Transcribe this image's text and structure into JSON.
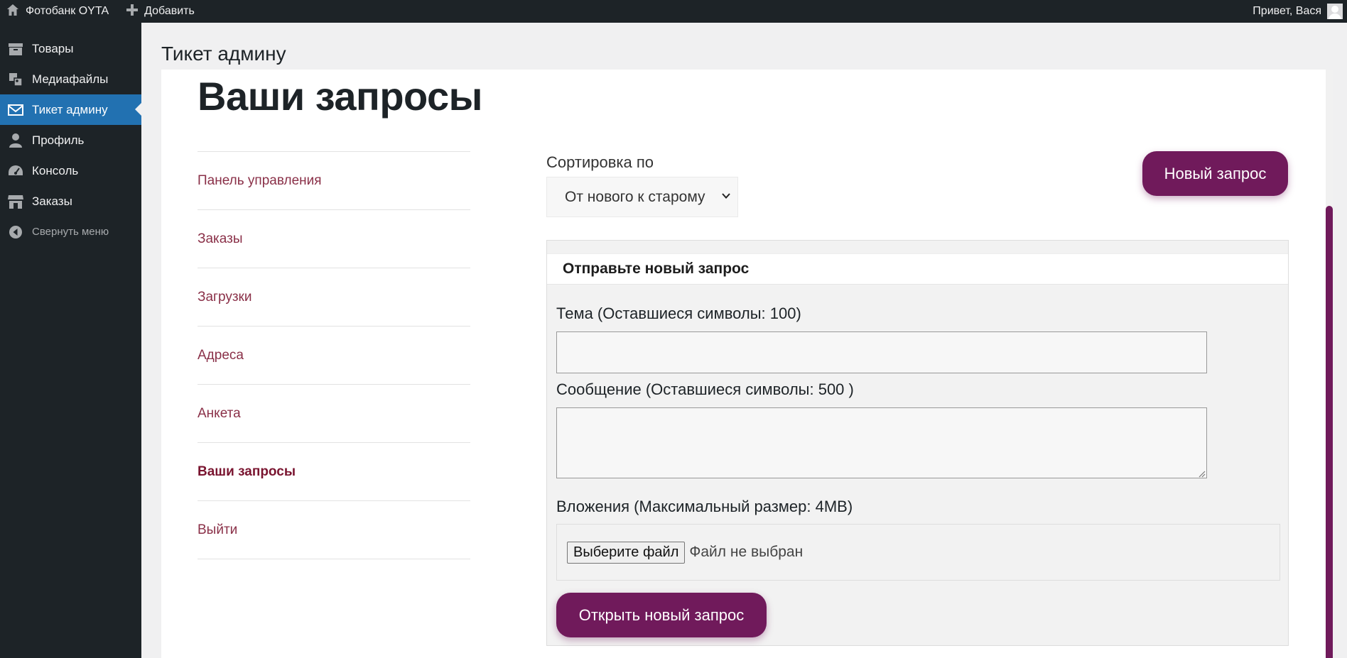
{
  "adminbar": {
    "site_name": "Фотобанк OYTA",
    "add_label": "Добавить",
    "greeting": "Привет, Вася"
  },
  "admin_menu": {
    "items": [
      {
        "label": "Товары",
        "icon": "archive-icon"
      },
      {
        "label": "Медиафайлы",
        "icon": "media-icon"
      },
      {
        "label": "Тикет админу",
        "icon": "envelope-icon"
      },
      {
        "label": "Профиль",
        "icon": "user-icon"
      },
      {
        "label": "Консоль",
        "icon": "dashboard-icon"
      },
      {
        "label": "Заказы",
        "icon": "store-icon"
      }
    ],
    "collapse_label": "Свернуть меню"
  },
  "page": {
    "heading": "Тикет админу",
    "title": "Ваши запросы"
  },
  "account_nav": {
    "items": [
      "Панель управления",
      "Заказы",
      "Загрузки",
      "Адреса",
      "Анкета",
      "Ваши запросы",
      "Выйти"
    ],
    "active": "Ваши запросы"
  },
  "sort": {
    "label": "Сортировка по",
    "selected": "От нового к старому"
  },
  "new_request_button": "Новый запрос",
  "form": {
    "heading": "Отправьте новый запрос",
    "subject_label": "Тема (Оставшиеся символы: 100)",
    "subject_value": "",
    "message_label": "Сообщение (Оставшиеся символы: 500 )",
    "message_value": "",
    "attach_label": "Вложения (Максимальный размер: 4MB)",
    "file_button": "Выберите файл",
    "file_status": "Файл не выбран",
    "submit_label": "Открыть новый запрос"
  },
  "colors": {
    "accent": "#701a5b",
    "admin_bg": "#1d2327",
    "menu_current": "#2271b1",
    "nav_link": "#8a3048"
  }
}
